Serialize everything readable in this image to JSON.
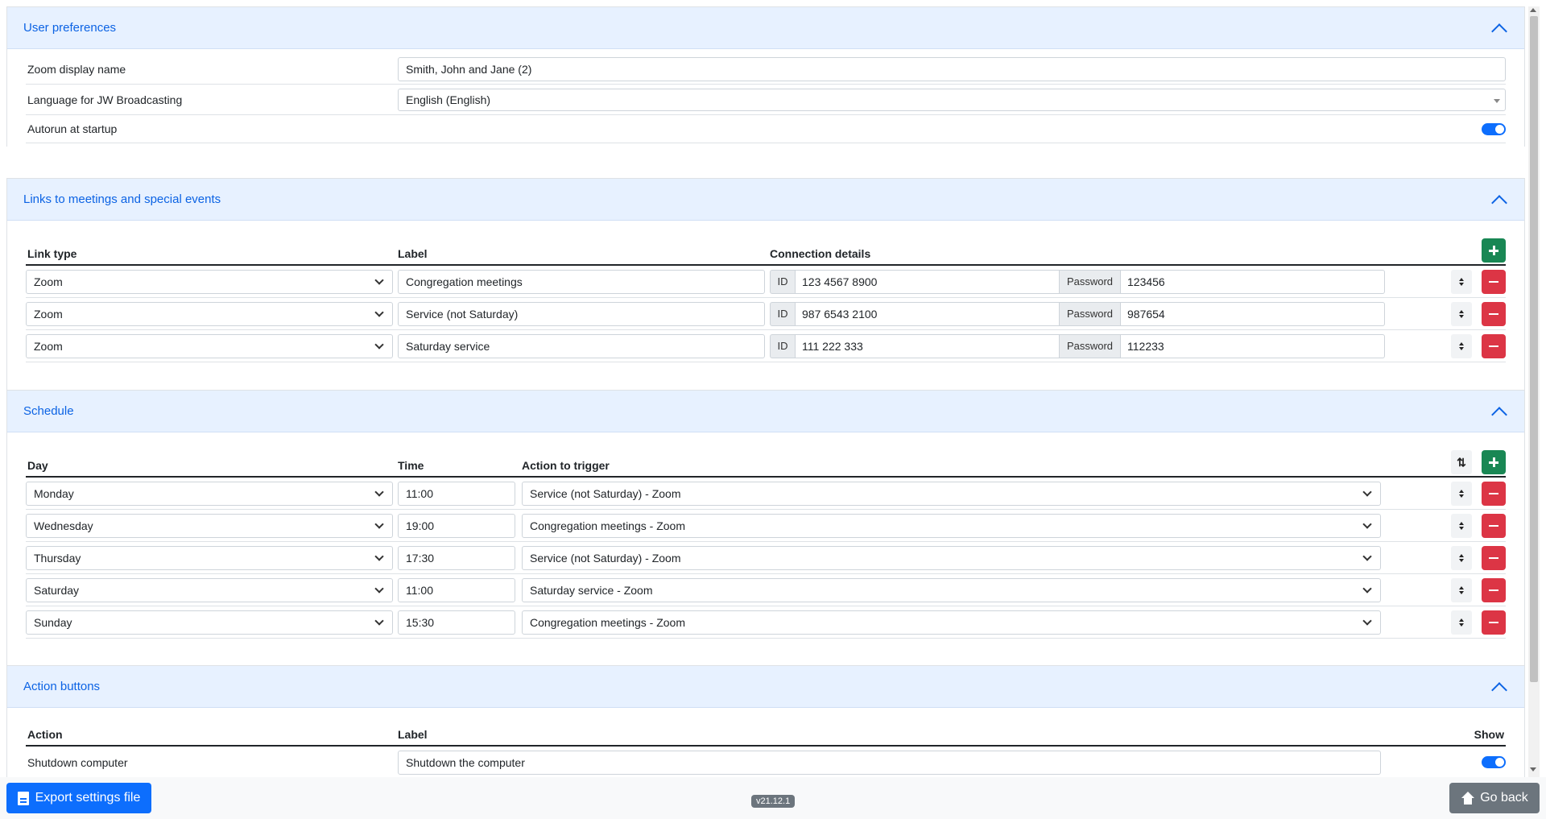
{
  "preferences": {
    "title": "User preferences",
    "zoom_label": "Zoom display name",
    "zoom_value": "Smith, John and Jane (2)",
    "lang_label": "Language for JW Broadcasting",
    "lang_value": "English (English)",
    "autorun_label": "Autorun at startup",
    "autorun_on": true
  },
  "links": {
    "title": "Links to meetings and special events",
    "headers": {
      "type": "Link type",
      "label": "Label",
      "details": "Connection details"
    },
    "id_label": "ID",
    "password_label": "Password",
    "rows": [
      {
        "type": "Zoom",
        "label": "Congregation meetings",
        "id": "123 4567 8900",
        "password": "123456"
      },
      {
        "type": "Zoom",
        "label": "Service (not Saturday)",
        "id": "987 6543 2100",
        "password": "987654"
      },
      {
        "type": "Zoom",
        "label": "Saturday service",
        "id": "111 222 333",
        "password": "112233"
      }
    ]
  },
  "schedule": {
    "title": "Schedule",
    "headers": {
      "day": "Day",
      "time": "Time",
      "action": "Action to trigger"
    },
    "rows": [
      {
        "day": "Monday",
        "time": "11:00",
        "action": "Service (not Saturday) - Zoom"
      },
      {
        "day": "Wednesday",
        "time": "19:00",
        "action": "Congregation meetings - Zoom"
      },
      {
        "day": "Thursday",
        "time": "17:30",
        "action": "Service (not Saturday) - Zoom"
      },
      {
        "day": "Saturday",
        "time": "11:00",
        "action": "Saturday service - Zoom"
      },
      {
        "day": "Sunday",
        "time": "15:30",
        "action": "Congregation meetings - Zoom"
      }
    ]
  },
  "actions": {
    "title": "Action buttons",
    "headers": {
      "action": "Action",
      "label": "Label",
      "show": "Show"
    },
    "rows": [
      {
        "action": "Shutdown computer",
        "label": "Shutdown the computer",
        "show": true
      }
    ]
  },
  "footer": {
    "export_label": "Export settings file",
    "version": "v21.12.1",
    "back_label": "Go back"
  },
  "colors": {
    "accent": "#0d6efd",
    "danger": "#dc3545",
    "success": "#198754",
    "header_bg": "#e7f1ff"
  }
}
